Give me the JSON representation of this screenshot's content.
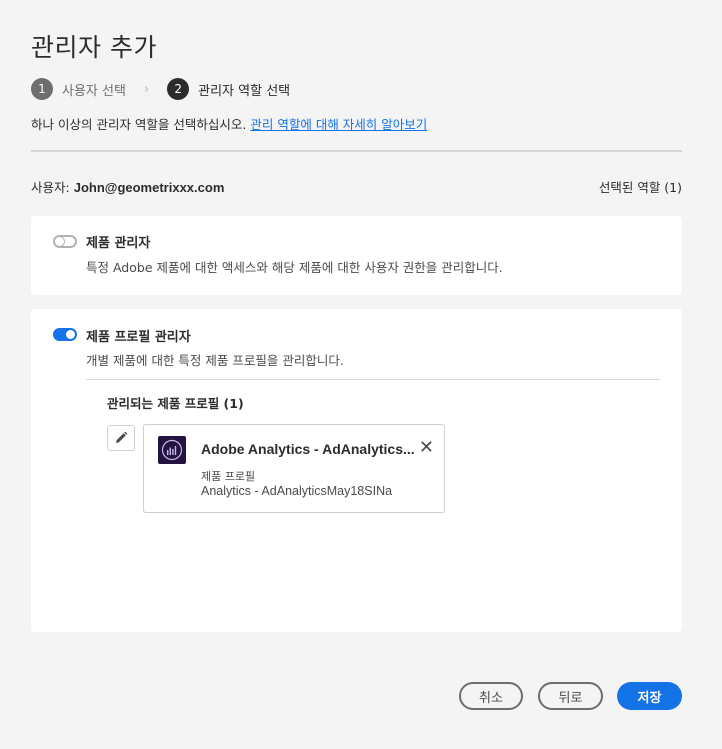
{
  "dialog": {
    "title": "관리자 추가"
  },
  "steps": [
    {
      "num": "1",
      "label": "사용자 선택"
    },
    {
      "num": "2",
      "label": "관리자 역할 선택"
    }
  ],
  "step_separator": "›",
  "description": {
    "text": "하나 이상의 관리자 역할을 선택하십시오.",
    "link": "관리 역할에 대해 자세히 알아보기"
  },
  "user": {
    "label": "사용자:",
    "email": "John@geometrixxx.com"
  },
  "selected_roles": "선택된 역할 (1)",
  "roles": [
    {
      "title": "제품 관리자",
      "desc": "특정 Adobe 제품에 대한 액세스와 해당 제품에 대한 사용자 권한을 관리합니다.",
      "enabled": false
    },
    {
      "title": "제품 프로필 관리자",
      "desc": "개별 제품에 대한 특정 제품 프로필을 관리합니다.",
      "enabled": true
    }
  ],
  "managed_profiles": {
    "title": "관리되는 제품 프로필 (1)",
    "items": [
      {
        "name": "Adobe Analytics - AdAnalytics...",
        "type": "제품 프로필",
        "profile": "Analytics - AdAnalyticsMay18SINa",
        "icon": "adobe-analytics-icon"
      }
    ]
  },
  "footer": {
    "cancel": "취소",
    "back": "뒤로",
    "save": "저장"
  },
  "colors": {
    "accent": "#1473e6",
    "background": "#f4f4f4",
    "card": "#ffffff",
    "analytics_icon_bg": "#24133f"
  }
}
